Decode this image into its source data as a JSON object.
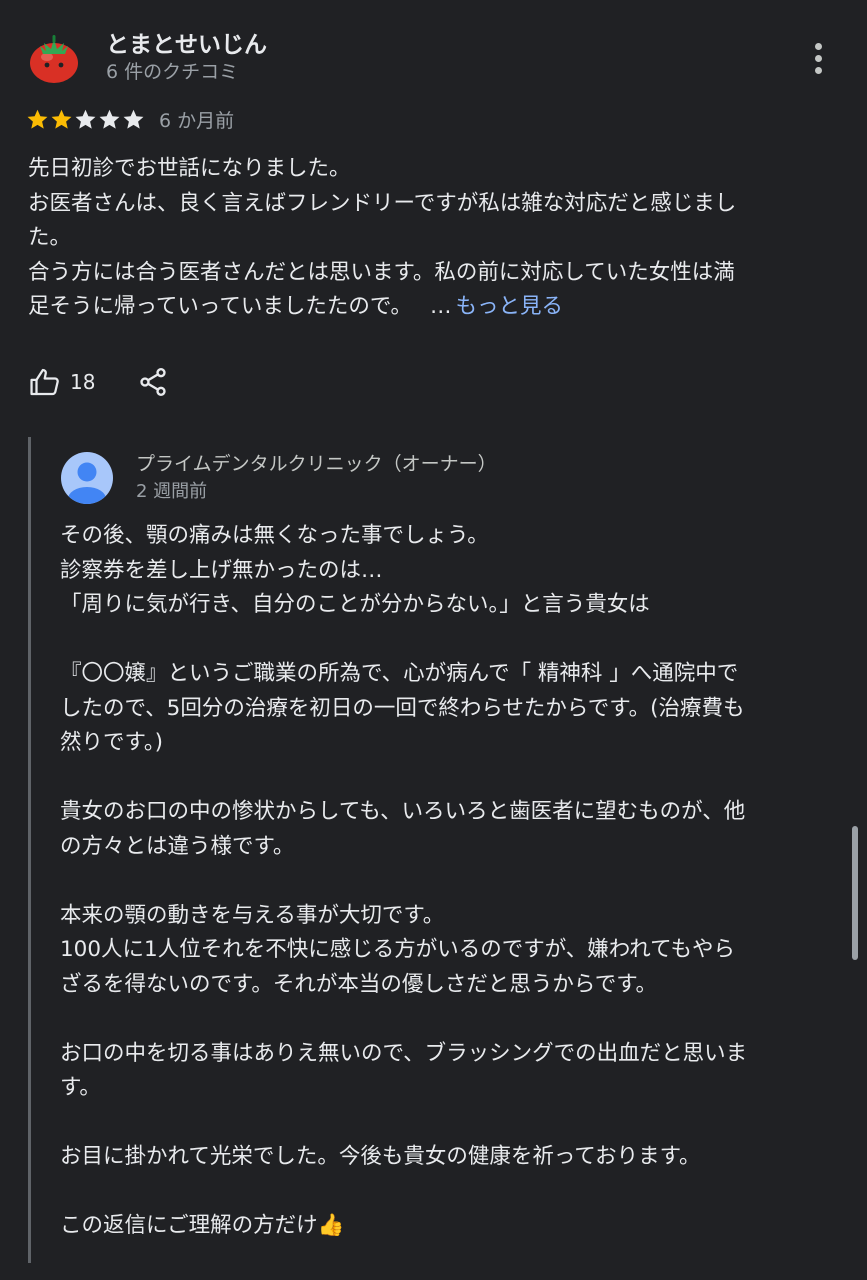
{
  "review": {
    "reviewer_name": "とまとせいじん",
    "review_count": "6 件のクチコミ",
    "rating": 2,
    "rating_max": 5,
    "date": "6 か月前",
    "text_lines": [
      "先日初診でお世話になりました。",
      "お医者さんは、良く言えばフレンドリーですが私は雑な対応だと感じまし",
      "た。",
      "合う方には合う医者さんだとは思います。私の前に対応していた女性は満",
      "足そうに帰っていっていましたたので。"
    ],
    "ellipsis": "…",
    "see_more_label": "もっと見る",
    "like_count": "18",
    "avatar_icon": "tomato-avatar-icon",
    "more_icon": "more-vert-icon",
    "like_icon": "thumbs-up-icon",
    "share_icon": "share-icon"
  },
  "owner_reply": {
    "name": "プライムデンタルクリニック（オーナー）",
    "date": "2 週間前",
    "avatar_icon": "default-user-avatar-icon",
    "text_lines": [
      "その後、顎の痛みは無くなった事でしょう。",
      "診察券を差し上げ無かったのは…",
      "「周りに気が行き、自分のことが分からない。」と言う貴女は",
      "",
      "『〇〇嬢』というご職業の所為で、心が病んで「 精神科 」へ通院中で",
      "したので、5回分の治療を初日の一回で終わらせたからです。(治療費も",
      "然りです。)",
      "",
      "貴女のお口の中の惨状からしても、いろいろと歯医者に望むものが、他",
      "の方々とは違う様です。",
      "",
      "本来の顎の動きを与える事が大切です。",
      "100人に1人位それを不快に感じる方がいるのですが、嫌われてもやら",
      "ざるを得ないのです。それが本当の優しさだと思うからです。",
      "",
      "お口の中を切る事はありえ無いので、ブラッシングでの出血だと思いま",
      "す。",
      "",
      "お目に掛かれて光栄でした。今後も貴女の健康を祈っております。",
      "",
      "この返信にご理解の方だけ👍"
    ]
  },
  "colors": {
    "background": "#202124",
    "text": "#e8eaed",
    "secondary_text": "#9aa0a6",
    "link": "#8ab4f8",
    "star_filled": "#fbbc04",
    "star_empty": "#e8eaed",
    "reply_border": "#5f6368"
  }
}
